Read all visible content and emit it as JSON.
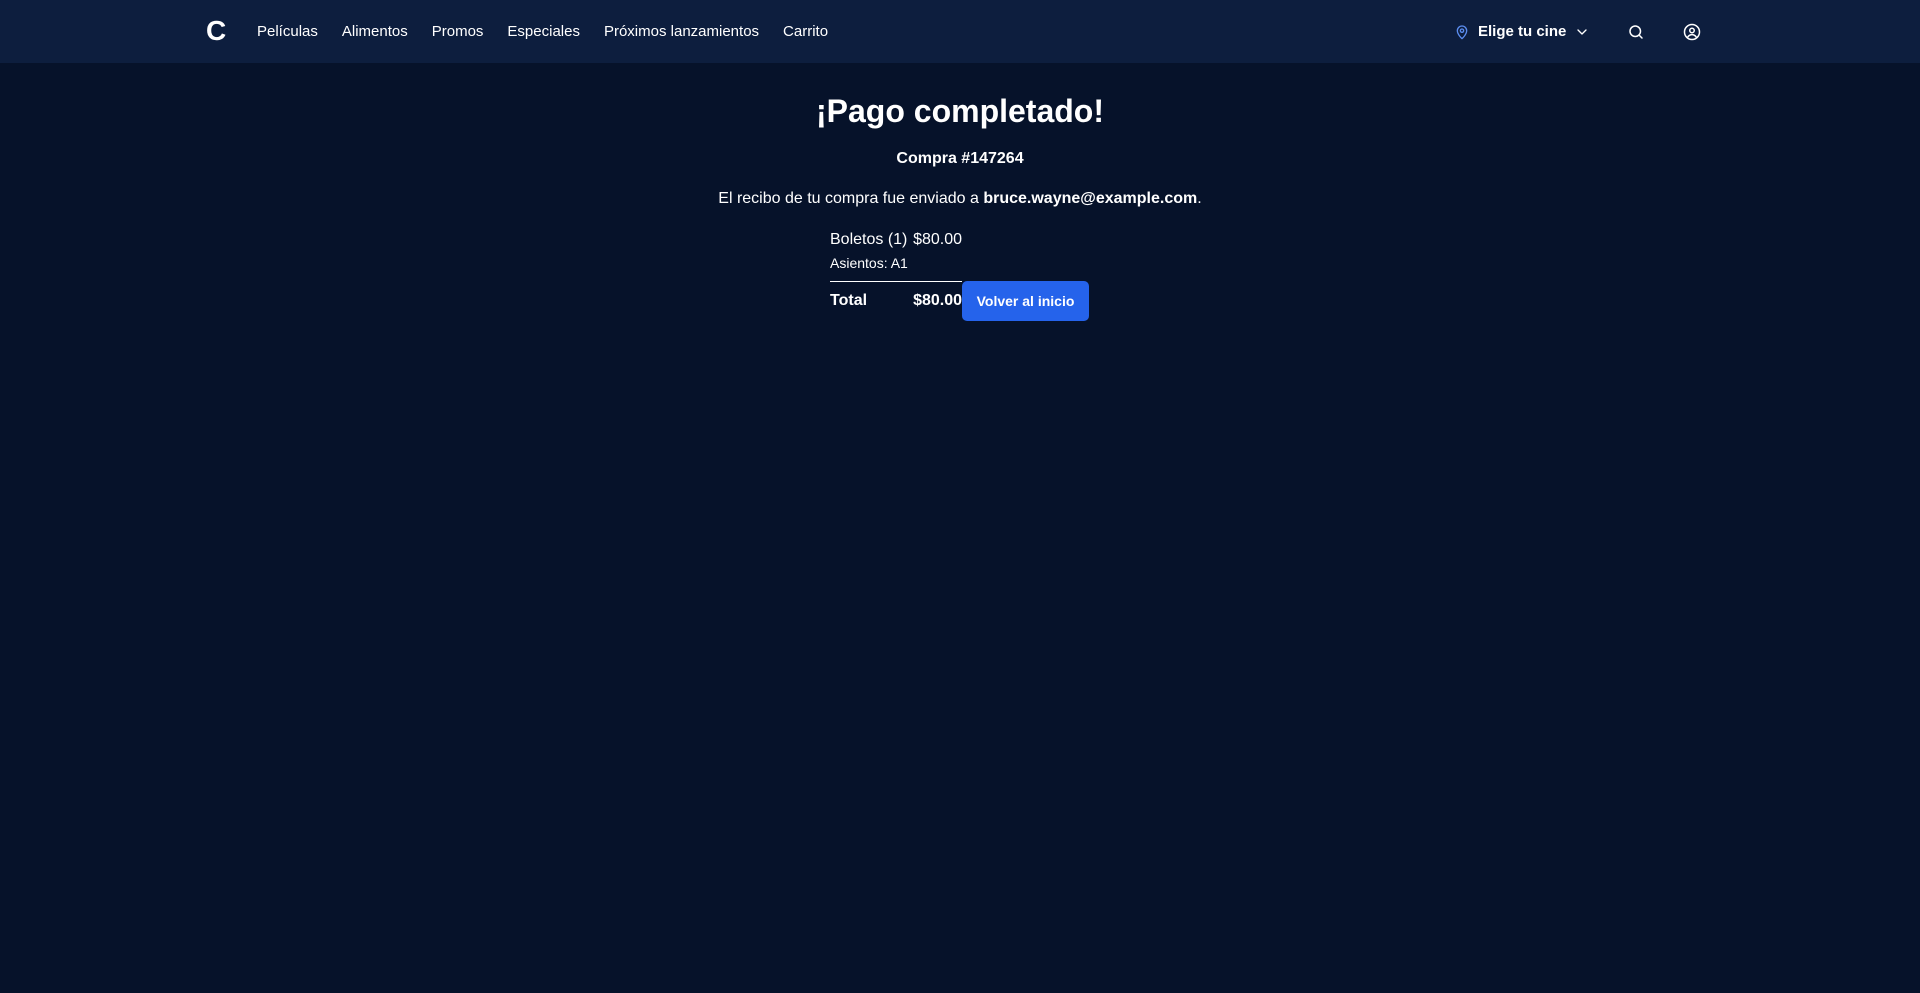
{
  "header": {
    "logo_text": "C",
    "nav": [
      "Películas",
      "Alimentos",
      "Promos",
      "Especiales",
      "Próximos lanzamientos",
      "Carrito"
    ],
    "cinema_selector": "Elige tu cine",
    "icons": {
      "location": "map-pin-icon",
      "chevron": "chevron-down-icon",
      "search": "search-icon",
      "user": "user-circle-icon"
    }
  },
  "main": {
    "title": "¡Pago completado!",
    "order": "Compra #147264",
    "receipt_prefix": "El recibo de tu compra fue enviado a ",
    "email": "bruce.wayne@example.com",
    "receipt_suffix": ".",
    "items": [
      {
        "label": "Boletos (1)",
        "price": "$80.00",
        "detail": "Asientos: A1"
      }
    ],
    "total_label": "Total",
    "total_value": "$80.00",
    "home_button": "Volver al inicio"
  },
  "colors": {
    "background": "#06122a",
    "header": "#0d1e3e",
    "accent": "#2563eb",
    "pin": "#5b8def"
  }
}
